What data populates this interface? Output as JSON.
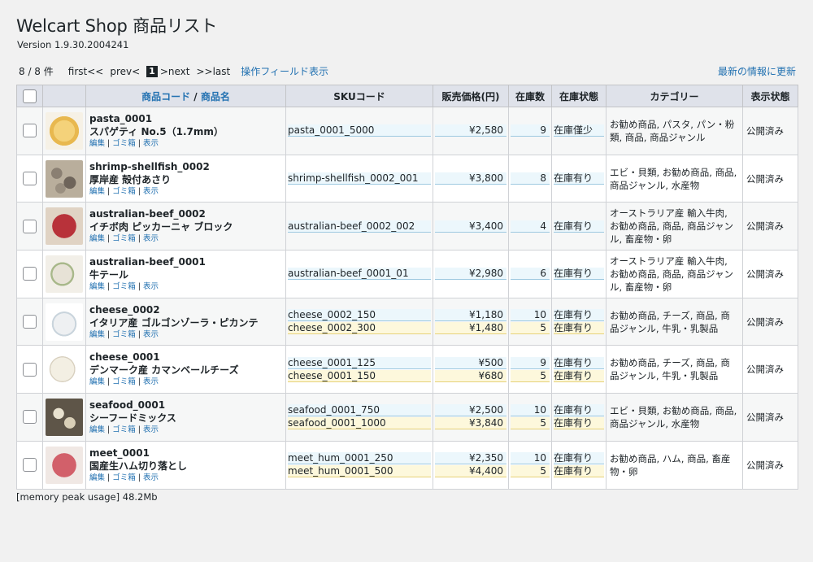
{
  "page": {
    "title": "Welcart Shop 商品リスト",
    "version": "Version 1.9.30.2004241",
    "count": "8 / 8 件",
    "first": "first<<",
    "prev": "prev<",
    "current_page": "1",
    "next": ">next",
    "last": ">>last",
    "field_toggle": "操作フィールド表示",
    "refresh": "最新の情報に更新",
    "memory": "[memory peak usage] 48.2Mb"
  },
  "columns": {
    "code": "商品コード",
    "slash": " / ",
    "name": "商品名",
    "sku": "SKUコード",
    "price": "販売価格(円)",
    "stock": "在庫数",
    "stock_status": "在庫状態",
    "category": "カテゴリー",
    "display": "表示状態"
  },
  "actions": {
    "edit": "編集",
    "trash": "ゴミ箱",
    "view": "表示",
    "sep": "|"
  },
  "colors": {
    "link": "#2271b1",
    "header_bg": "#dfe2ea",
    "sku_blue": "#ecf7fc",
    "sku_yellow": "#fdf8dc"
  },
  "items": [
    {
      "code": "pasta_0001",
      "name": "スパゲティ No.5（1.7mm）",
      "thumb": "pasta-thumbnail",
      "sku_lines": [
        {
          "sku": "pasta_0001_5000",
          "price": "¥2,580",
          "stock": "9",
          "status": "在庫僅少"
        }
      ],
      "category": "お勧め商品, パスタ, パン・粉類, 商品, 商品ジャンル",
      "display": "公開済み"
    },
    {
      "code": "shrimp-shellfish_0002",
      "name": "厚岸産 殻付あさり",
      "thumb": "clams-thumbnail",
      "sku_lines": [
        {
          "sku": "shrimp-shellfish_0002_001",
          "price": "¥3,800",
          "stock": "8",
          "status": "在庫有り"
        }
      ],
      "category": "エビ・貝類, お勧め商品, 商品, 商品ジャンル, 水産物",
      "display": "公開済み"
    },
    {
      "code": "australian-beef_0002",
      "name": "イチボ肉 ピッカーニャ ブロック",
      "thumb": "beef-thumbnail",
      "sku_lines": [
        {
          "sku": "australian-beef_0002_002",
          "price": "¥3,400",
          "stock": "4",
          "status": "在庫有り"
        }
      ],
      "category": "オーストラリア産 輸入牛肉, お勧め商品, 商品, 商品ジャンル, 畜産物・卵",
      "display": "公開済み"
    },
    {
      "code": "australian-beef_0001",
      "name": "牛テール",
      "thumb": "oxtail-thumbnail",
      "sku_lines": [
        {
          "sku": "australian-beef_0001_01",
          "price": "¥2,980",
          "stock": "6",
          "status": "在庫有り"
        }
      ],
      "category": "オーストラリア産 輸入牛肉, お勧め商品, 商品, 商品ジャンル, 畜産物・卵",
      "display": "公開済み"
    },
    {
      "code": "cheese_0002",
      "name": "イタリア産 ゴルゴンゾーラ・ピカンテ",
      "thumb": "gorgonzola-thumbnail",
      "sku_lines": [
        {
          "sku": "cheese_0002_150",
          "price": "¥1,180",
          "stock": "10",
          "status": "在庫有り"
        },
        {
          "sku": "cheese_0002_300",
          "price": "¥1,480",
          "stock": "5",
          "status": "在庫有り"
        }
      ],
      "category": "お勧め商品, チーズ, 商品, 商品ジャンル, 牛乳・乳製品",
      "display": "公開済み"
    },
    {
      "code": "cheese_0001",
      "name": "デンマーク産 カマンベールチーズ",
      "thumb": "camembert-thumbnail",
      "sku_lines": [
        {
          "sku": "cheese_0001_125",
          "price": "¥500",
          "stock": "9",
          "status": "在庫有り"
        },
        {
          "sku": "cheese_0001_150",
          "price": "¥680",
          "stock": "5",
          "status": "在庫有り"
        }
      ],
      "category": "お勧め商品, チーズ, 商品, 商品ジャンル, 牛乳・乳製品",
      "display": "公開済み"
    },
    {
      "code": "seafood_0001",
      "name": "シーフードミックス",
      "thumb": "seafood-thumbnail",
      "sku_lines": [
        {
          "sku": "seafood_0001_750",
          "price": "¥2,500",
          "stock": "10",
          "status": "在庫有り"
        },
        {
          "sku": "seafood_0001_1000",
          "price": "¥3,840",
          "stock": "5",
          "status": "在庫有り"
        }
      ],
      "category": "エビ・貝類, お勧め商品, 商品, 商品ジャンル, 水産物",
      "display": "公開済み"
    },
    {
      "code": "meet_0001",
      "name": "国産生ハム切り落とし",
      "thumb": "ham-thumbnail",
      "sku_lines": [
        {
          "sku": "meet_hum_0001_250",
          "price": "¥2,350",
          "stock": "10",
          "status": "在庫有り"
        },
        {
          "sku": "meet_hum_0001_500",
          "price": "¥4,400",
          "stock": "5",
          "status": "在庫有り"
        }
      ],
      "category": "お勧め商品, ハム, 商品, 畜産物・卵",
      "display": "公開済み"
    }
  ]
}
